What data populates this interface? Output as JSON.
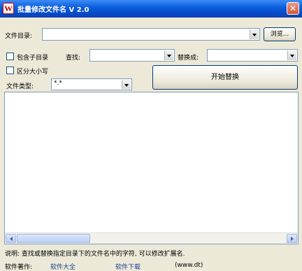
{
  "window": {
    "title": "批量修改文件名 V 2.0",
    "close_glyph": "✕",
    "icon_letter": "W"
  },
  "form": {
    "dir_label": "文件目录:",
    "dir_value": "",
    "browse_label": "浏览...",
    "include_subdirs_label": "包含子目录",
    "include_subdirs_checked": false,
    "find_label": "查找:",
    "find_value": "",
    "replace_label": "替换成:",
    "replace_value": "",
    "case_sensitive_label": "区分大小写",
    "case_sensitive_checked": false,
    "file_type_label": "文件类型:",
    "file_type_value": "*.*",
    "start_button_label": "开始替换"
  },
  "results": {
    "items": []
  },
  "footer": {
    "description": "说明: 查找或替换指定目录下的文件名中的字符, 可以修改扩展名.",
    "bottom_label": "软件著作:",
    "link1": "软件大全",
    "link2": "软件下载",
    "extra": "(www.dt)"
  },
  "icons": {
    "app": "app-icon",
    "close": "close-icon",
    "dropdown": "chevron-down-icon",
    "scroll_left": "arrow-left-icon",
    "scroll_right": "arrow-right-icon"
  }
}
